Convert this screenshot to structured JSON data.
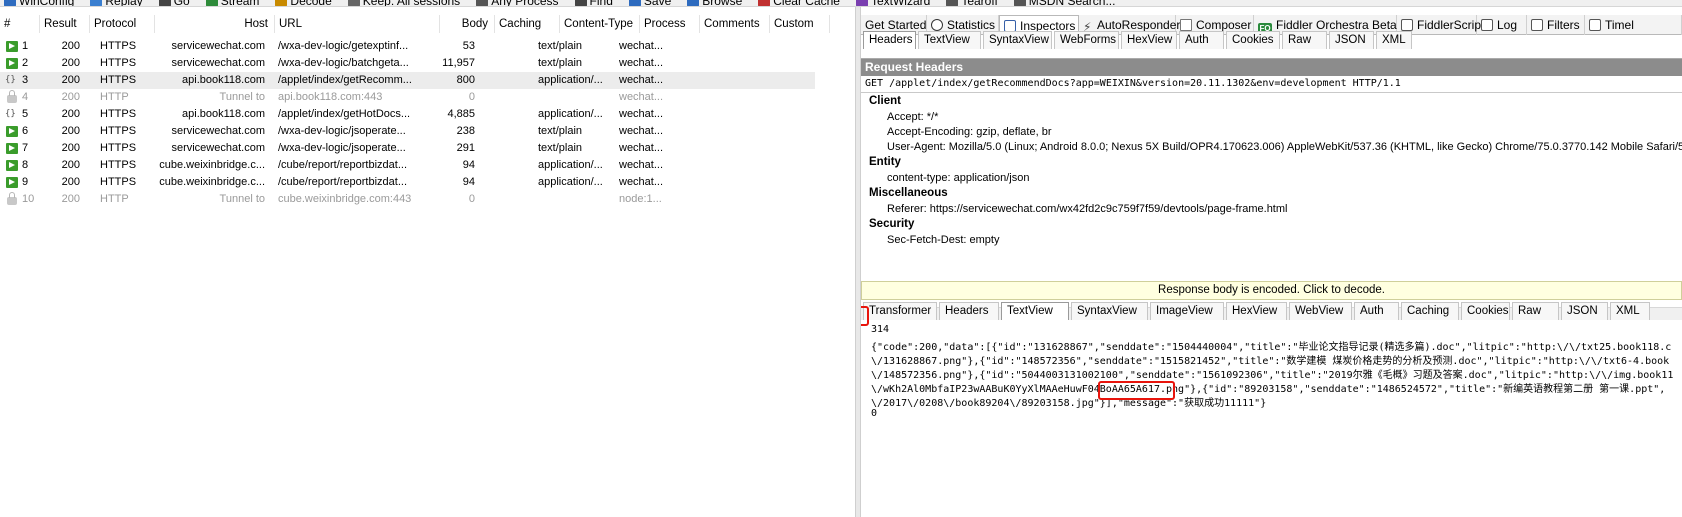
{
  "toolbar": {
    "items": [
      "WinConfig",
      "Replay",
      "Go",
      "Stream",
      "Decode",
      "Keep: All sessions",
      "Any Process",
      "Find",
      "Save",
      "Browse",
      "Clear Cache",
      "TextWizard",
      "Tearoff",
      "MSDN Search..."
    ]
  },
  "sessions": {
    "columns": [
      "#",
      "Result",
      "Protocol",
      "Host",
      "URL",
      "Body",
      "Caching",
      "Content-Type",
      "Process",
      "Comments",
      "Custom"
    ],
    "rows": [
      {
        "num": "1",
        "result": "200",
        "protocol": "HTTPS",
        "host": "servicewechat.com",
        "url": "/wxa-dev-logic/getexptinf...",
        "body": "53",
        "caching": "",
        "ctype": "text/plain",
        "process": "wechat...",
        "icon": "arrow"
      },
      {
        "num": "2",
        "result": "200",
        "protocol": "HTTPS",
        "host": "servicewechat.com",
        "url": "/wxa-dev-logic/batchgeta...",
        "body": "11,957",
        "caching": "",
        "ctype": "text/plain",
        "process": "wechat...",
        "icon": "arrow"
      },
      {
        "num": "3",
        "result": "200",
        "protocol": "HTTPS",
        "host": "api.book118.com",
        "url": "/applet/index/getRecomm...",
        "body": "800",
        "caching": "",
        "ctype": "application/...",
        "process": "wechat...",
        "icon": "json"
      },
      {
        "num": "4",
        "result": "200",
        "protocol": "HTTP",
        "host": "Tunnel to",
        "url": "api.book118.com:443",
        "body": "0",
        "caching": "",
        "ctype": "",
        "process": "wechat...",
        "icon": "lock"
      },
      {
        "num": "5",
        "result": "200",
        "protocol": "HTTPS",
        "host": "api.book118.com",
        "url": "/applet/index/getHotDocs...",
        "body": "4,885",
        "caching": "",
        "ctype": "application/...",
        "process": "wechat...",
        "icon": "json"
      },
      {
        "num": "6",
        "result": "200",
        "protocol": "HTTPS",
        "host": "servicewechat.com",
        "url": "/wxa-dev-logic/jsoperate...",
        "body": "238",
        "caching": "",
        "ctype": "text/plain",
        "process": "wechat...",
        "icon": "arrow"
      },
      {
        "num": "7",
        "result": "200",
        "protocol": "HTTPS",
        "host": "servicewechat.com",
        "url": "/wxa-dev-logic/jsoperate...",
        "body": "291",
        "caching": "",
        "ctype": "text/plain",
        "process": "wechat...",
        "icon": "arrow"
      },
      {
        "num": "8",
        "result": "200",
        "protocol": "HTTPS",
        "host": "cube.weixinbridge.c...",
        "url": "/cube/report/reportbizdat...",
        "body": "94",
        "caching": "",
        "ctype": "application/...",
        "process": "wechat...",
        "icon": "arrow"
      },
      {
        "num": "9",
        "result": "200",
        "protocol": "HTTPS",
        "host": "cube.weixinbridge.c...",
        "url": "/cube/report/reportbizdat...",
        "body": "94",
        "caching": "",
        "ctype": "application/...",
        "process": "wechat...",
        "icon": "arrow"
      },
      {
        "num": "10",
        "result": "200",
        "protocol": "HTTP",
        "host": "Tunnel to",
        "url": "cube.weixinbridge.com:443",
        "body": "0",
        "caching": "",
        "ctype": "",
        "process": "node:1...",
        "icon": "lock"
      }
    ]
  },
  "main_tabs": [
    "Get Started",
    "Statistics",
    "Inspectors",
    "AutoResponder",
    "Composer",
    "Fiddler Orchestra Beta",
    "FiddlerScript",
    "Log",
    "Filters",
    "Timel"
  ],
  "request_tabs": [
    "Headers",
    "TextView",
    "SyntaxView",
    "WebForms",
    "HexView",
    "Auth",
    "Cookies",
    "Raw",
    "JSON",
    "XML"
  ],
  "request_headers": {
    "title": "Request Headers",
    "request_line": "GET /applet/index/getRecommendDocs?app=WEIXIN&version=20.11.1302&env=development HTTP/1.1",
    "groups": [
      {
        "name": "Client",
        "lines": [
          "Accept: */*",
          "Accept-Encoding: gzip, deflate, br",
          "User-Agent: Mozilla/5.0 (Linux; Android 8.0.0; Nexus 5X Build/OPR4.170623.006) AppleWebKit/537.36 (KHTML, like Gecko) Chrome/75.0.3770.142 Mobile Safari/537"
        ]
      },
      {
        "name": "Entity",
        "lines": [
          "content-type: application/json"
        ]
      },
      {
        "name": "Miscellaneous",
        "lines": [
          "Referer: https://servicewechat.com/wx42fd2c9c759f7f59/devtools/page-frame.html"
        ]
      },
      {
        "name": "Security",
        "lines": [
          "Sec-Fetch-Dest: empty"
        ]
      }
    ],
    "scroll_left": "<"
  },
  "encoded_bar": "Response body is encoded. Click to decode.",
  "response_tabs": [
    "Transformer",
    "Headers",
    "TextView",
    "SyntaxView",
    "ImageView",
    "HexView",
    "WebView",
    "Auth",
    "Caching",
    "Cookies",
    "Raw",
    "JSON",
    "XML"
  ],
  "response_body": {
    "lines": [
      "314",
      "{\"code\":200,\"data\":[{\"id\":\"131628867\",\"senddate\":\"1504440004\",\"title\":\"毕业论文指导记录(精选多篇).doc\",\"litpic\":\"http:\\/\\/txt25.book118.c",
      "\\/131628867.png\"},{\"id\":\"148572356\",\"senddate\":\"1515821452\",\"title\":\"数学建模 煤炭价格走势的分析及预测.doc\",\"litpic\":\"http:\\/\\/txt6-4.book",
      "\\/148572356.png\"},{\"id\":\"5044003131002100\",\"senddate\":\"1561092306\",\"title\":\"2019尔雅《毛概》习题及答案.doc\",\"litpic\":\"http:\\/\\/img.book11",
      "\\/wKh2Al0MbfaIP23wAABuK0YyXlMAAeHuwF04BoAA65A617.png\"},{\"id\":\"89203158\",\"senddate\":\"1486524572\",\"title\":\"新编英语教程第二册  第一课.ppt\",",
      "\\/2017\\/0208\\/book89204\\/89203158.jpg\"}],\"message\":\"获取成功11111\"}",
      "0"
    ]
  }
}
